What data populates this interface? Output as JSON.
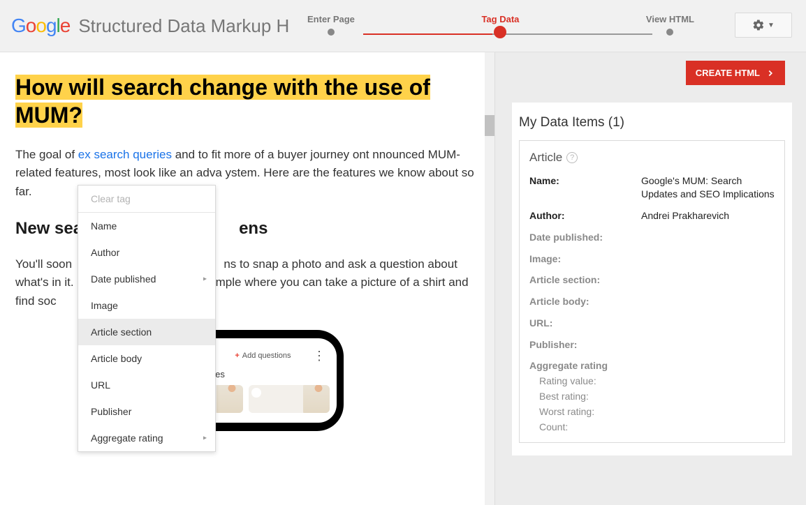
{
  "header": {
    "app_title": "Structured Data Markup H",
    "steps": [
      "Enter Page",
      "Tag Data",
      "View HTML"
    ],
    "active_step_index": 1
  },
  "create_button": "CREATE HTML",
  "article": {
    "heading": "How will search change with the use of MUM?",
    "para1_pre": "The goal of",
    "para1_link": "ex search queries",
    "para1_post": " and to fit more of a buyer journey ont                                         nnounced MUM-related features, most look like an adva                                  ystem. Here are the features we know about so far.",
    "sub_heading_pre": "New sea",
    "sub_heading_post": "ens",
    "para2": "You'll soon                                              ns to snap a photo and ask a question about what's in it.                                           mple where you can take a picture of a shirt and find soc                                        :"
  },
  "phone": {
    "add_questions": "Add questions",
    "visual_matches": "Visual matches"
  },
  "context_menu": {
    "clear_tag": "Clear tag",
    "items": [
      "Name",
      "Author",
      "Date published",
      "Image",
      "Article section",
      "Article body",
      "URL",
      "Publisher",
      "Aggregate rating"
    ],
    "highlighted_index": 4,
    "submenu_indices": [
      2,
      8
    ]
  },
  "sidebar": {
    "panel_title": "My Data Items (1)",
    "card_type": "Article",
    "rows": {
      "name": {
        "label": "Name:",
        "value": "Google's MUM: Search Updates and SEO Implications"
      },
      "author": {
        "label": "Author:",
        "value": "Andrei Prakharevich"
      },
      "date_published": {
        "label": "Date published:"
      },
      "image": {
        "label": "Image:"
      },
      "article_section": {
        "label": "Article section:"
      },
      "article_body": {
        "label": "Article body:"
      },
      "url": {
        "label": "URL:"
      },
      "publisher": {
        "label": "Publisher:"
      }
    },
    "aggregate": {
      "head": "Aggregate rating",
      "subs": [
        "Rating value:",
        "Best rating:",
        "Worst rating:",
        "Count:"
      ]
    }
  }
}
